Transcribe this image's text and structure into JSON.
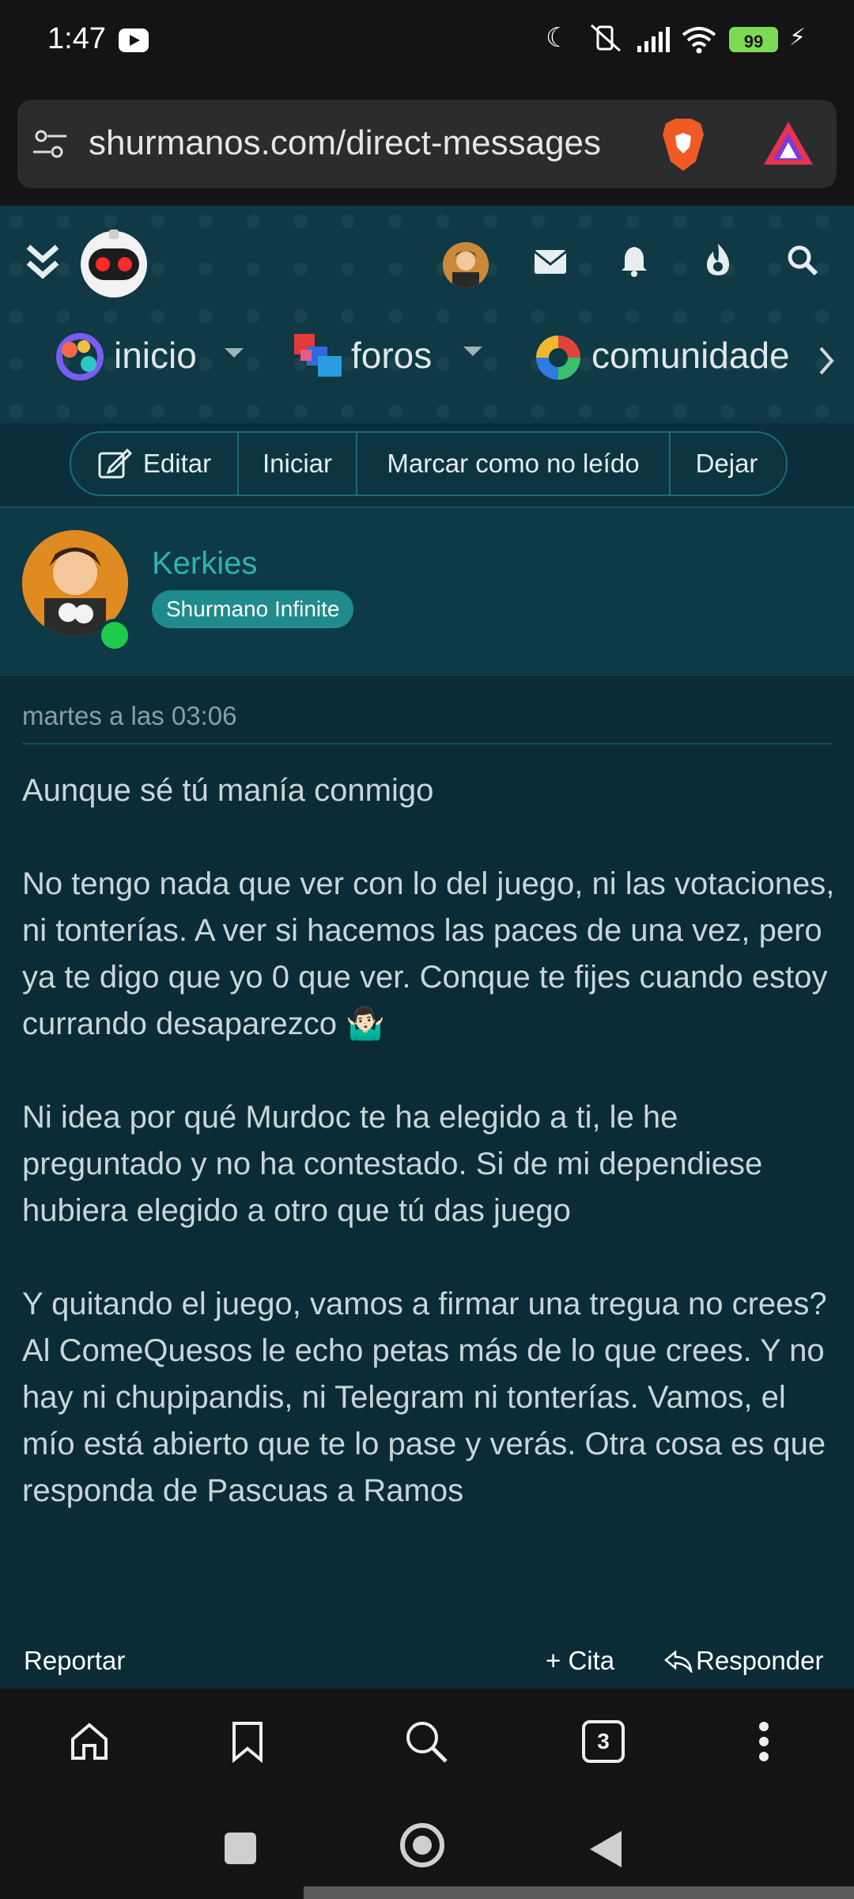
{
  "status_bar": {
    "time": "1:47",
    "battery": "99",
    "icons": [
      "youtube-icon",
      "moon-icon",
      "vibrate-off-icon",
      "signal-icon",
      "wifi-icon",
      "battery-icon",
      "charging-icon"
    ]
  },
  "browser": {
    "url": "shurmanos.com/direct-messages",
    "tab_count": "3"
  },
  "site_nav": {
    "items": [
      {
        "label": "inicio"
      },
      {
        "label": "foros"
      },
      {
        "label": "comunidade"
      }
    ]
  },
  "actions": {
    "edit": "Editar",
    "start": "Iniciar",
    "mark_unread": "Marcar como no leído",
    "leave": "Dejar"
  },
  "message": {
    "author": "Kerkies",
    "badge": "Shurmano Infinite",
    "timestamp": "martes a las 03:06",
    "paragraphs": [
      "Aunque sé tú manía conmigo",
      "No tengo nada que ver con lo del juego, ni las votaciones, ni tonterías. A ver si hacemos las paces de una vez, pero ya te digo que yo 0 que ver. Conque te fijes cuando estoy currando desaparezco 🤷🏻‍♂️",
      "Ni idea por qué Murdoc te ha elegido a ti, le he preguntado y no ha contestado. Si de mi dependiese hubiera elegido a otro que tú das juego",
      "Y quitando el juego, vamos a firmar una tregua no crees? Al ComeQuesos le echo petas más de lo que crees. Y no hay ni chupipandis, ni Telegram ni tonterías. Vamos, el mío está abierto que te lo pase y verás. Otra cosa es que responda de Pascuas a Ramos"
    ],
    "report": "Reportar",
    "quote": "+ Cita",
    "reply": "Responder"
  },
  "colors": {
    "accent": "#2fb3b0",
    "badge": "#1f8b8c",
    "online": "#1ecb4b",
    "background": "#0b2b36"
  }
}
